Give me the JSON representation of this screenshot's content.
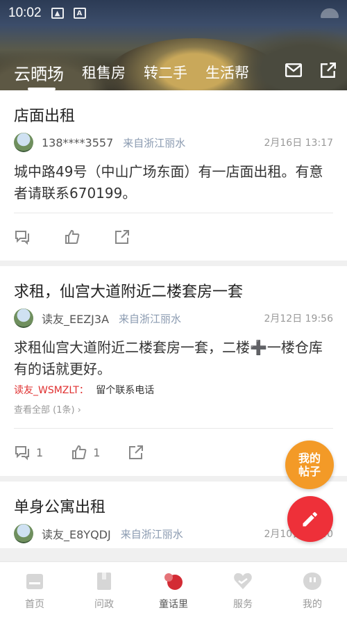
{
  "status_bar": {
    "time": "10:02"
  },
  "tabs": [
    {
      "label": "云晒场",
      "active": true
    },
    {
      "label": "租售房",
      "active": false
    },
    {
      "label": "转二手",
      "active": false
    },
    {
      "label": "生活帮",
      "active": false
    }
  ],
  "header_icons": [
    "mail-icon",
    "share-icon"
  ],
  "posts": [
    {
      "title": "店面出租",
      "author": "138****3557",
      "location": "来自浙江丽水",
      "time": "2月16日 13:17",
      "content": "城中路49号（中山广场东面）有一店面出租。有意者请联系670199。",
      "comment_count": "",
      "like_count": ""
    },
    {
      "title": "求租，仙宫大道附近二楼套房一套",
      "author": "读友_EEZJ3A",
      "location": "来自浙江丽水",
      "time": "2月12日 19:56",
      "content": "求租仙宫大道附近二楼套房一套，二楼➕一楼仓库有的话就更好。",
      "comment_author": "读友_WSMZLT：",
      "comment_text": "留个联系电话",
      "view_all": "查看全部 (1条) ›",
      "comment_count": "1",
      "like_count": "1"
    },
    {
      "title": "单身公寓出租",
      "author": "读友_E8YQDJ",
      "location": "来自浙江丽水",
      "time": "2月10日 13:40"
    }
  ],
  "fab": {
    "my_posts_label": "我的帖子"
  },
  "bottom_nav": [
    {
      "label": "首页",
      "icon": "home-icon",
      "active": false
    },
    {
      "label": "问政",
      "icon": "question-icon",
      "active": false
    },
    {
      "label": "童话里",
      "icon": "community-icon",
      "active": true
    },
    {
      "label": "服务",
      "icon": "heart-icon",
      "active": false
    },
    {
      "label": "我的",
      "icon": "profile-icon",
      "active": false
    }
  ],
  "colors": {
    "accent_red": "#ee3039",
    "fab_orange": "#f39a27",
    "location_blue": "#8a9ab0"
  }
}
